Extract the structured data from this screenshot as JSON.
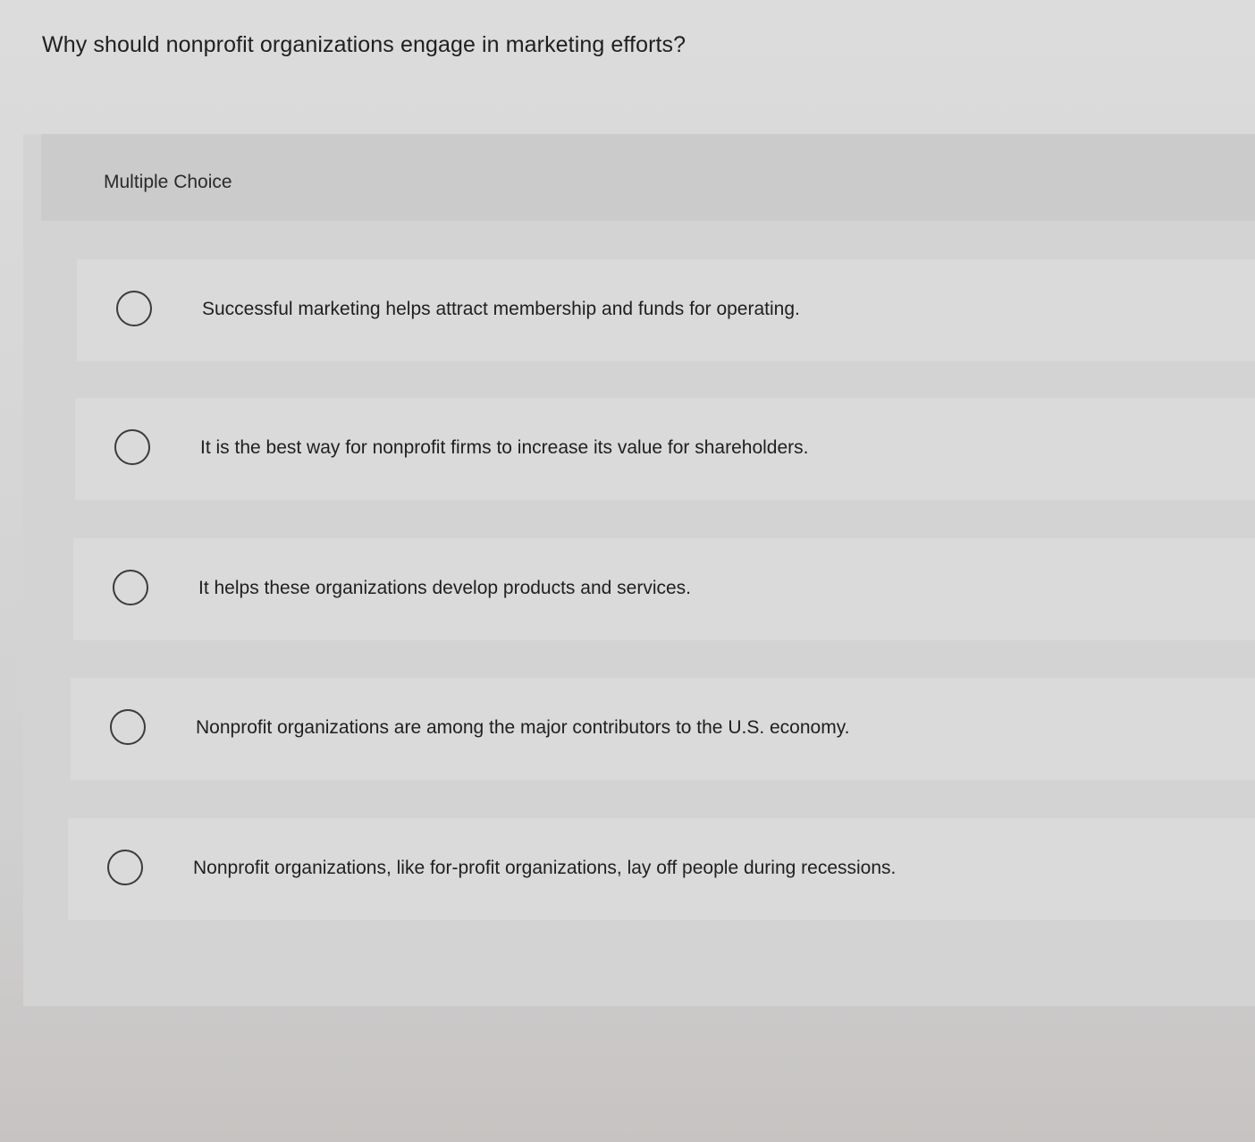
{
  "question": {
    "text": "Why should nonprofit organizations engage in marketing efforts?"
  },
  "panel": {
    "header_label": "Multiple Choice"
  },
  "options": [
    {
      "label": "Successful marketing helps attract membership and funds for operating.",
      "selected": false
    },
    {
      "label": "It is the best way for nonprofit firms to increase its value for shareholders.",
      "selected": false
    },
    {
      "label": "It helps these organizations develop products and services.",
      "selected": false
    },
    {
      "label": "Nonprofit organizations are among the major contributors to the U.S. economy.",
      "selected": false
    },
    {
      "label": "Nonprofit organizations, like for-profit organizations, lay off people during recessions.",
      "selected": false
    }
  ]
}
